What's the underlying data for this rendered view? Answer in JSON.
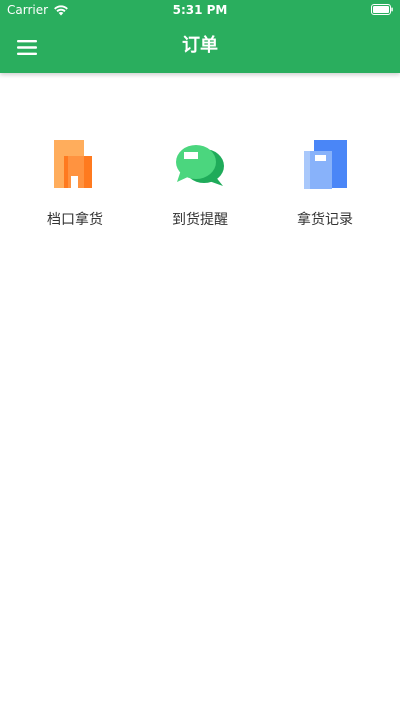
{
  "status_bar": {
    "carrier": "Carrier",
    "time": "5:31 PM"
  },
  "header": {
    "title": "订单",
    "background_color": "#2aae5e",
    "menu_icon": "hamburger-menu-icon"
  },
  "grid": {
    "items": [
      {
        "label": "档口拿货",
        "icon": "stall-shop-icon",
        "color": "#ff8a2b"
      },
      {
        "label": "到货提醒",
        "icon": "chat-bubbles-icon",
        "color": "#2fc16d"
      },
      {
        "label": "拿货记录",
        "icon": "documents-record-icon",
        "color": "#4c8dff"
      }
    ]
  }
}
